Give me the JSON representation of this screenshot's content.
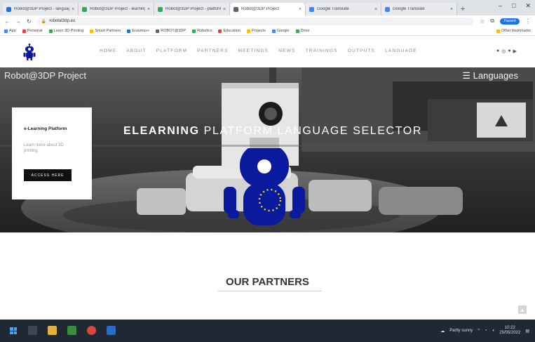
{
  "browser": {
    "tabs": [
      {
        "label": "Robot@3DP Project - languages",
        "favicon_color": "#1a73e8",
        "active": false
      },
      {
        "label": "Robot@3DP Project - learning",
        "favicon_color": "#34a853",
        "active": false
      },
      {
        "label": "Robot@3DP Project - platform",
        "favicon_color": "#34a853",
        "active": false
      },
      {
        "label": "Robot@3DP Project",
        "favicon_color": "#5f6368",
        "active": true
      },
      {
        "label": "Google Translate",
        "favicon_color": "#4285f4",
        "active": false
      },
      {
        "label": "Google Translate",
        "favicon_color": "#4285f4",
        "active": false
      }
    ],
    "url": "robotat3dp.eu",
    "profile_label": "Paused",
    "bookmarks": [
      "App",
      "Personal",
      "Learn 3D Printing",
      "Smart Partners",
      "Erasmus+",
      "ROBOT@3DP",
      "Robotics",
      "Education",
      "Projects",
      "Google",
      "Drive",
      "Other bookmarks"
    ]
  },
  "site": {
    "nav": [
      "HOME",
      "ABOUT",
      "PLATFORM",
      "PARTNERS",
      "MEETINGS",
      "NEWS",
      "TRAININGS",
      "OUTPUTS",
      "LANGUAGE"
    ],
    "social_icons": [
      "facebook-icon",
      "instagram-icon",
      "twitter-icon",
      "youtube-icon"
    ]
  },
  "hero": {
    "brand": "Robot@3DP Project",
    "languages_label": "Languages",
    "title_bold": "ELEARNING",
    "title_rest": " PLATFORM LANGUAGE SELECTOR",
    "card": {
      "title": "e-Learning Platform",
      "text": "Learn more about 3D printing",
      "button": "ACCESS HERE"
    }
  },
  "partners": {
    "title": "OUR PARTNERS"
  },
  "taskbar": {
    "tray_text": "Partly sunny",
    "time": "10:22",
    "date": "25/05/2022"
  },
  "colors": {
    "robot_blue": "#0a1a9e",
    "eu_yellow": "#ffd400",
    "taskbar_bg": "#202833",
    "hero_bg": "#2b2b2b"
  }
}
